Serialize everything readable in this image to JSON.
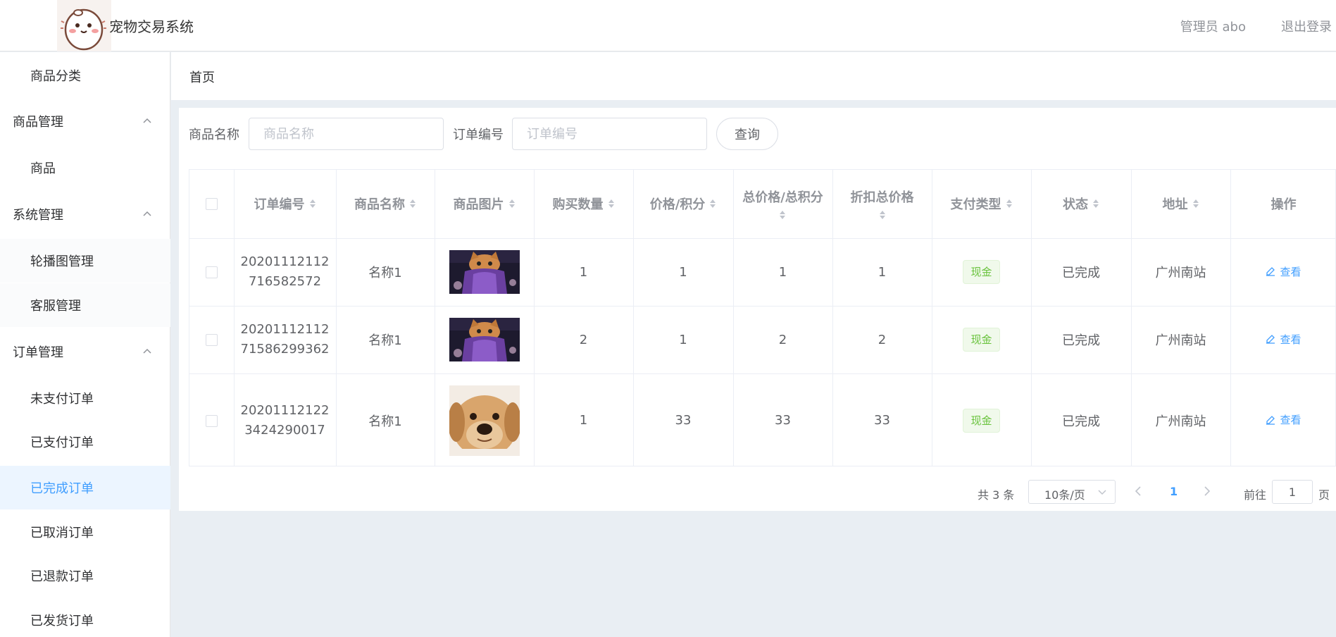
{
  "app": {
    "title": "宠物交易系统"
  },
  "header": {
    "admin": "管理员 abo",
    "logout": "退出登录"
  },
  "sidebar": {
    "items": [
      {
        "label": "商品分类",
        "kind": "child"
      },
      {
        "label": "商品管理",
        "kind": "group",
        "expanded": true
      },
      {
        "label": "商品",
        "kind": "child"
      },
      {
        "label": "系统管理",
        "kind": "group",
        "expanded": true
      },
      {
        "label": "轮播图管理",
        "kind": "child"
      },
      {
        "label": "客服管理",
        "kind": "child"
      },
      {
        "label": "订单管理",
        "kind": "group",
        "expanded": true
      },
      {
        "label": "未支付订单",
        "kind": "child"
      },
      {
        "label": "已支付订单",
        "kind": "child"
      },
      {
        "label": "已完成订单",
        "kind": "child",
        "active": true
      },
      {
        "label": "已取消订单",
        "kind": "child"
      },
      {
        "label": "已退款订单",
        "kind": "child"
      },
      {
        "label": "已发货订单",
        "kind": "child"
      }
    ]
  },
  "breadcrumb": {
    "home": "首页"
  },
  "search": {
    "product_label": "商品名称",
    "product_placeholder": "商品名称",
    "order_label": "订单编号",
    "order_placeholder": "订单编号",
    "button": "查询"
  },
  "table": {
    "headers": [
      "订单编号",
      "商品名称",
      "商品图片",
      "购买数量",
      "价格/积分",
      "总价格/总积分",
      "折扣总价格",
      "支付类型",
      "状态",
      "地址",
      "操作"
    ],
    "rows": [
      {
        "order_no_1": "20201112112",
        "order_no_2": "716582572",
        "name": "名称1",
        "image": "cat-photo",
        "qty": "1",
        "price": "1",
        "total": "1",
        "discount_total": "1",
        "pay_type": "现金",
        "status": "已完成",
        "address": "广州南站",
        "action": "查看"
      },
      {
        "order_no_1": "20201112112",
        "order_no_2": "71586299362",
        "name": "名称1",
        "image": "cat-photo",
        "qty": "2",
        "price": "1",
        "total": "2",
        "discount_total": "2",
        "pay_type": "现金",
        "status": "已完成",
        "address": "广州南站",
        "action": "查看"
      },
      {
        "order_no_1": "20201112122",
        "order_no_2": "3424290017",
        "name": "名称1",
        "image": "dog-photo",
        "qty": "1",
        "price": "33",
        "total": "33",
        "discount_total": "33",
        "pay_type": "现金",
        "status": "已完成",
        "address": "广州南站",
        "action": "查看"
      }
    ]
  },
  "pagination": {
    "total": "共 3 条",
    "page_size": "10条/页",
    "current_page": "1",
    "goto": "前往",
    "goto_value": "1",
    "page_suffix": "页"
  },
  "colors": {
    "accent": "#409eff",
    "success": "#67c23a",
    "page_bg": "#e9eef3"
  },
  "icons": {
    "sort": "sort-caret-icon",
    "collapse": "chevron-up-icon",
    "edit": "edit-icon"
  }
}
